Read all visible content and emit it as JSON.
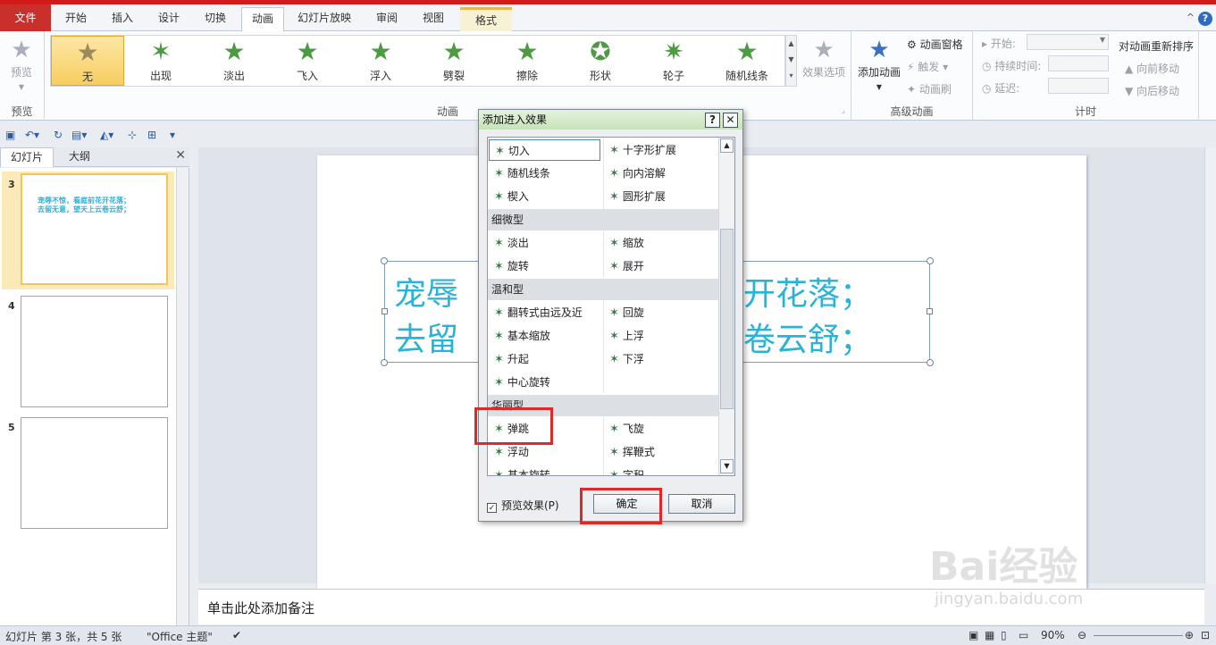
{
  "ribbon_tabs": [
    "文件",
    "开始",
    "插入",
    "设计",
    "切换",
    "动画",
    "幻灯片放映",
    "审阅",
    "视图",
    "格式"
  ],
  "ribbon": {
    "preview_label": "预览",
    "preview_group": "预览",
    "animation_group": "动画",
    "gallery": [
      "无",
      "出现",
      "淡出",
      "飞入",
      "浮入",
      "劈裂",
      "擦除",
      "形状",
      "轮子",
      "随机线条"
    ],
    "effect_options": "效果选项",
    "add_animation": "添加动画",
    "animation_pane": "动画窗格",
    "trigger": "触发",
    "animation_painter": "动画刷",
    "advanced_group": "高级动画",
    "start_label": "开始:",
    "duration_label": "持续时间:",
    "delay_label": "延迟:",
    "timing_group": "计时",
    "reorder_title": "对动画重新排序",
    "move_earlier": "向前移动",
    "move_later": "向后移动"
  },
  "pane": {
    "tab_slides": "幻灯片",
    "tab_outline": "大纲",
    "slides": [
      {
        "num": "3",
        "line1": "宠辱不惊，看庭前花开花落；",
        "line2": "去留无意，望天上云卷云舒；"
      },
      {
        "num": "4"
      },
      {
        "num": "5"
      }
    ]
  },
  "slide": {
    "line1_left": "宠辱",
    "line1_right": "开花落；",
    "line2_left": "去留",
    "line2_right": "卷云舒；"
  },
  "notes_placeholder": "单击此处添加备注",
  "status": {
    "slide_info": "幻灯片 第 3 张，共 5 张",
    "theme": "\"Office 主题\"",
    "zoom": "90%"
  },
  "dialog": {
    "title": "添加进入效果",
    "help": "?",
    "close": "✕",
    "basic": [
      [
        "切入",
        "十字形扩展"
      ],
      [
        "随机线条",
        "向内溶解"
      ],
      [
        "楔入",
        "圆形扩展"
      ]
    ],
    "subtle_header": "细微型",
    "subtle": [
      [
        "淡出",
        "缩放"
      ],
      [
        "旋转",
        "展开"
      ]
    ],
    "moderate_header": "温和型",
    "moderate": [
      [
        "翻转式由远及近",
        "回旋"
      ],
      [
        "基本缩放",
        "上浮"
      ],
      [
        "升起",
        "下浮"
      ],
      [
        "中心旋转",
        ""
      ]
    ],
    "exciting_header": "华丽型",
    "exciting": [
      [
        "弹跳",
        "飞旋"
      ],
      [
        "浮动",
        "挥鞭式"
      ],
      [
        "基本旋转",
        "字积"
      ]
    ],
    "preview_label": "预览效果(P)",
    "ok": "确定",
    "cancel": "取消"
  },
  "watermark": {
    "brand": "Bai经验",
    "url": "jingyan.baidu.com"
  }
}
